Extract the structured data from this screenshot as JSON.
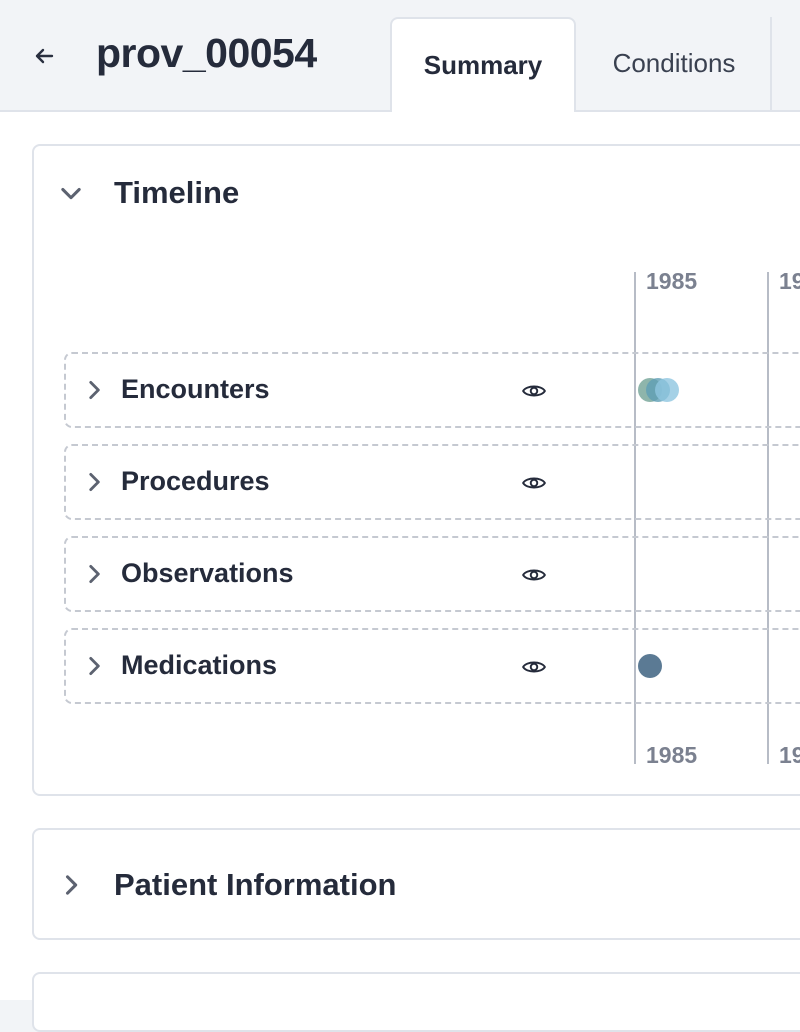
{
  "header": {
    "title": "prov_00054",
    "tabs": [
      {
        "label": "Summary",
        "active": true
      },
      {
        "label": "Conditions",
        "active": false
      }
    ]
  },
  "timeline": {
    "title": "Timeline",
    "expanded": true,
    "axis_years": [
      "1985",
      "1985"
    ],
    "rows": [
      {
        "label": "Encounters",
        "events_in_view": 3
      },
      {
        "label": "Procedures",
        "events_in_view": 0
      },
      {
        "label": "Observations",
        "events_in_view": 0
      },
      {
        "label": "Medications",
        "events_in_view": 1
      }
    ],
    "colors": {
      "encounter_dots": [
        "#7aa89c",
        "#5f9fb5",
        "#8ec6e0"
      ],
      "medication_dot": "#5b7a94",
      "axis_line": "#b7bcc6",
      "row_border": "#c5c9d1"
    }
  },
  "patient_information": {
    "title": "Patient Information",
    "expanded": false
  },
  "icons": {
    "back": "arrow-left-icon",
    "collapse": "chevron-down-icon",
    "expand": "chevron-right-icon",
    "visibility": "eye-icon"
  }
}
